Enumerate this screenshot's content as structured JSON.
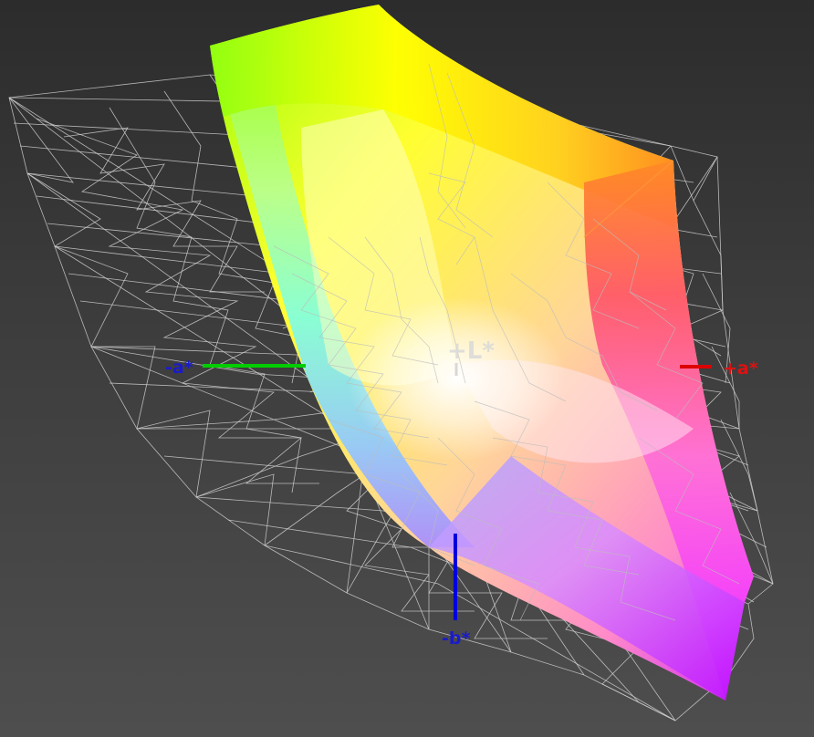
{
  "axes": {
    "plus_l": "+L*",
    "minus_a": "-a*",
    "plus_a": "+a*",
    "minus_b": "-b*"
  },
  "colors": {
    "background_top": "#2c2c2c",
    "background_bottom": "#4e4e4e",
    "wireframe": "#cfcfcf",
    "axis_a_negative": "#00cc00",
    "axis_a_positive": "#dd0000",
    "axis_b_negative": "#0000dd",
    "label_minus_a": "#1a1acc",
    "label_plus_a": "#dd1111",
    "label_minus_b": "#1a1acc",
    "label_plus_l": "#d8d8d8"
  }
}
